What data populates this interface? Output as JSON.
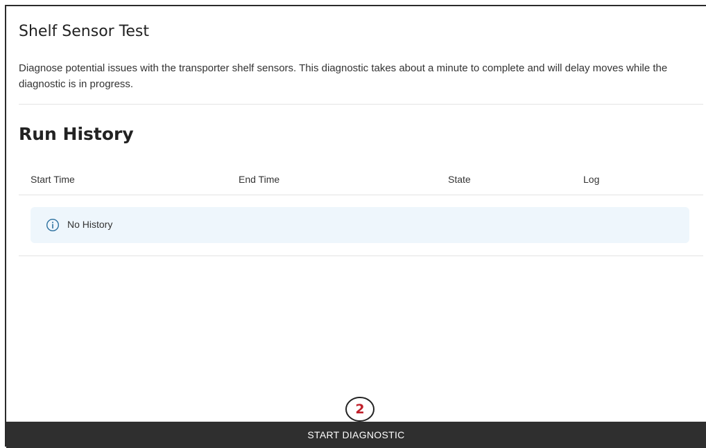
{
  "section": {
    "title": "Shelf Sensor Test",
    "description": "Diagnose potential issues with the transporter shelf sensors. This diagnostic takes about a minute to complete and will delay moves while the diagnostic is in progress."
  },
  "history": {
    "title": "Run History",
    "columns": [
      "Start Time",
      "End Time",
      "State",
      "Log"
    ],
    "empty_message": "No History",
    "empty_icon": "info-icon"
  },
  "annotation": {
    "step_number": "2",
    "color": "#c0202b"
  },
  "actions": {
    "start_label": "START DIAGNOSTIC"
  },
  "colors": {
    "button_bg": "#2f2f2f",
    "info_bg": "#eef6fc",
    "info_icon": "#2a6f9e"
  }
}
